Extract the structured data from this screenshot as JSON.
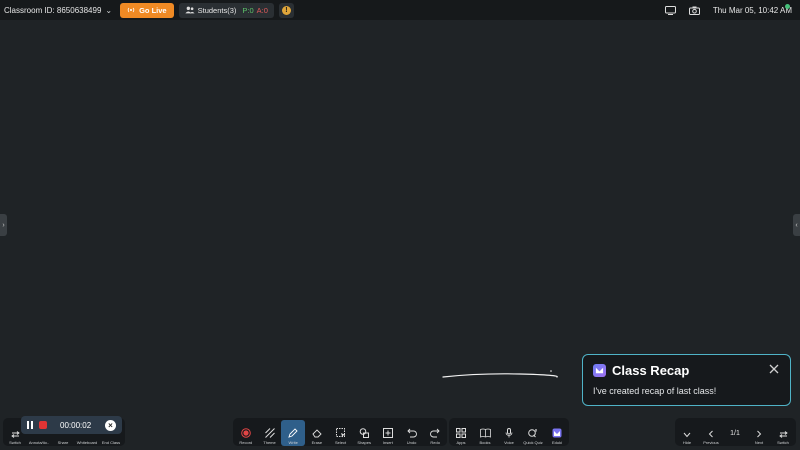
{
  "topbar": {
    "classroom_id": "Classroom ID: 8650638499",
    "go_live": "Go Live",
    "students_label": "Students(3)",
    "present": "P:0",
    "absent": "A:0",
    "warning": "!",
    "datetime": "Thu Mar 05, 10:42 AM"
  },
  "recap": {
    "title": "Class Recap",
    "message": "I've created recap of last class!"
  },
  "recording": {
    "time": "00:00:02",
    "close": "×"
  },
  "left_tools": [
    "Switch",
    "Annota/tio..",
    "Share",
    "Whiteboard",
    "End Class"
  ],
  "main_tools": [
    "Record",
    "Theme",
    "Write",
    "Erase",
    "Select",
    "Shapes",
    "Insert",
    "Undo",
    "Redo"
  ],
  "app_tools": [
    "Apps",
    "Books",
    "Voice",
    "Quick Quiz",
    "Eduki"
  ],
  "nav": {
    "hide": "Hide",
    "previous": "Previous",
    "page": "1/1",
    "next": "Next",
    "switch": "Switch"
  },
  "colors": {
    "canvas": "#1f2326",
    "accent_orange": "#f08a24",
    "recap_border": "#4fb3c7",
    "active_tool": "#2f5f8a"
  }
}
